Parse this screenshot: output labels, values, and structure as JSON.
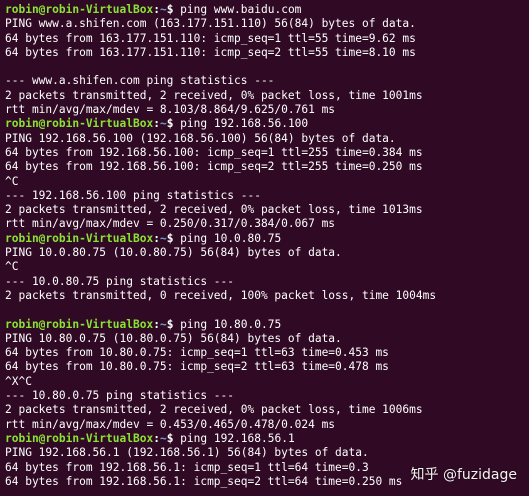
{
  "terminal": {
    "lines": [
      {
        "type": "prompt",
        "user": "robin@robin-VirtualBox",
        "path": "~",
        "command": " ping www.baidu.com"
      },
      {
        "type": "out",
        "text": "PING www.a.shifen.com (163.177.151.110) 56(84) bytes of data."
      },
      {
        "type": "out",
        "text": "64 bytes from 163.177.151.110: icmp_seq=1 ttl=55 time=9.62 ms"
      },
      {
        "type": "out",
        "text": "64 bytes from 163.177.151.110: icmp_seq=2 ttl=55 time=8.10 ms"
      },
      {
        "type": "out",
        "text": ""
      },
      {
        "type": "out",
        "text": "--- www.a.shifen.com ping statistics ---"
      },
      {
        "type": "out",
        "text": "2 packets transmitted, 2 received, 0% packet loss, time 1001ms"
      },
      {
        "type": "out",
        "text": "rtt min/avg/max/mdev = 8.103/8.864/9.625/0.761 ms"
      },
      {
        "type": "prompt",
        "user": "robin@robin-VirtualBox",
        "path": "~",
        "command": " ping 192.168.56.100"
      },
      {
        "type": "out",
        "text": "PING 192.168.56.100 (192.168.56.100) 56(84) bytes of data."
      },
      {
        "type": "out",
        "text": "64 bytes from 192.168.56.100: icmp_seq=1 ttl=255 time=0.384 ms"
      },
      {
        "type": "out",
        "text": "64 bytes from 192.168.56.100: icmp_seq=2 ttl=255 time=0.250 ms"
      },
      {
        "type": "out",
        "text": "^C"
      },
      {
        "type": "out",
        "text": "--- 192.168.56.100 ping statistics ---"
      },
      {
        "type": "out",
        "text": "2 packets transmitted, 2 received, 0% packet loss, time 1013ms"
      },
      {
        "type": "out",
        "text": "rtt min/avg/max/mdev = 0.250/0.317/0.384/0.067 ms"
      },
      {
        "type": "prompt",
        "user": "robin@robin-VirtualBox",
        "path": "~",
        "command": " ping 10.0.80.75"
      },
      {
        "type": "out",
        "text": "PING 10.0.80.75 (10.0.80.75) 56(84) bytes of data."
      },
      {
        "type": "out",
        "text": "^C"
      },
      {
        "type": "out",
        "text": "--- 10.0.80.75 ping statistics ---"
      },
      {
        "type": "out",
        "text": "2 packets transmitted, 0 received, 100% packet loss, time 1004ms"
      },
      {
        "type": "out",
        "text": ""
      },
      {
        "type": "prompt",
        "user": "robin@robin-VirtualBox",
        "path": "~",
        "command": " ping 10.80.0.75"
      },
      {
        "type": "out",
        "text": "PING 10.80.0.75 (10.80.0.75) 56(84) bytes of data."
      },
      {
        "type": "out",
        "text": "64 bytes from 10.80.0.75: icmp_seq=1 ttl=63 time=0.453 ms"
      },
      {
        "type": "out",
        "text": "64 bytes from 10.80.0.75: icmp_seq=2 ttl=63 time=0.478 ms"
      },
      {
        "type": "out",
        "text": "^X^C"
      },
      {
        "type": "out",
        "text": "--- 10.80.0.75 ping statistics ---"
      },
      {
        "type": "out",
        "text": "2 packets transmitted, 2 received, 0% packet loss, time 1006ms"
      },
      {
        "type": "out",
        "text": "rtt min/avg/max/mdev = 0.453/0.465/0.478/0.024 ms"
      },
      {
        "type": "prompt",
        "user": "robin@robin-VirtualBox",
        "path": "~",
        "command": " ping 192.168.56.1"
      },
      {
        "type": "out",
        "text": "PING 192.168.56.1 (192.168.56.1) 56(84) bytes of data."
      },
      {
        "type": "out",
        "text": "64 bytes from 192.168.56.1: icmp_seq=1 ttl=64 time=0.3"
      },
      {
        "type": "out",
        "text": "64 bytes from 192.168.56.1: icmp_seq=2 ttl=64 time=0.250 ms"
      }
    ]
  },
  "watermark": {
    "text": "知乎 @fuzidage"
  },
  "colors": {
    "background": "#300a24",
    "prompt_user": "#8ae234",
    "prompt_path": "#729fcf",
    "text": "#ffffff"
  }
}
